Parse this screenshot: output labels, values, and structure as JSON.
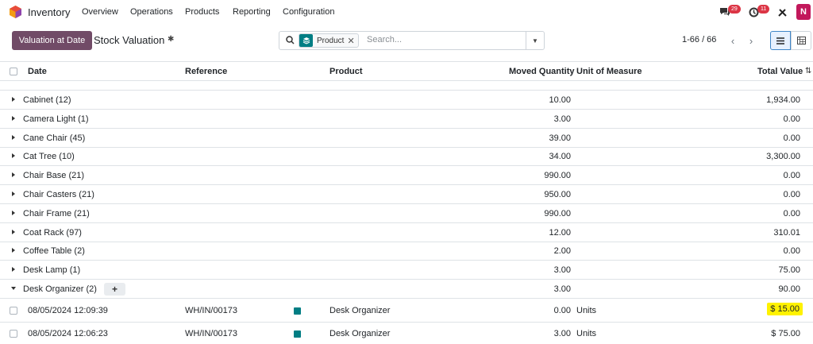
{
  "nav": {
    "app_name": "Inventory",
    "menus": [
      "Overview",
      "Operations",
      "Products",
      "Reporting",
      "Configuration"
    ],
    "chat_badge": "29",
    "activity_badge": "11",
    "user_initial": "N",
    "brand_color": "#714b67"
  },
  "control": {
    "valuation_button": "Valuation at Date",
    "title": "Stock Valuation",
    "facet_label": "Product",
    "search_placeholder": "Search...",
    "pager": "1-66 / 66"
  },
  "table": {
    "headers": {
      "date": "Date",
      "reference": "Reference",
      "product": "Product",
      "moved_quantity": "Moved Quantity",
      "uom": "Unit of Measure",
      "total_value": "Total Value"
    },
    "groups": [
      {
        "label": "Cabinet (12)",
        "qty": "10.00",
        "value": "1,934.00"
      },
      {
        "label": "Camera Light (1)",
        "qty": "3.00",
        "value": "0.00"
      },
      {
        "label": "Cane Chair (45)",
        "qty": "39.00",
        "value": "0.00"
      },
      {
        "label": "Cat Tree (10)",
        "qty": "34.00",
        "value": "3,300.00"
      },
      {
        "label": "Chair Base (21)",
        "qty": "990.00",
        "value": "0.00"
      },
      {
        "label": "Chair Casters (21)",
        "qty": "950.00",
        "value": "0.00"
      },
      {
        "label": "Chair Frame (21)",
        "qty": "990.00",
        "value": "0.00"
      },
      {
        "label": "Coat Rack (97)",
        "qty": "12.00",
        "value": "310.01"
      },
      {
        "label": "Coffee Table (2)",
        "qty": "2.00",
        "value": "0.00"
      },
      {
        "label": "Desk Lamp (1)",
        "qty": "3.00",
        "value": "75.00"
      }
    ],
    "open_group": {
      "label": "Desk Organizer (2)",
      "qty": "3.00",
      "value": "90.00"
    },
    "records": [
      {
        "date": "08/05/2024 12:09:39",
        "reference": "WH/IN/00173",
        "product": "Desk Organizer",
        "qty": "0.00",
        "uom": "Units",
        "value": "$ 15.00",
        "highlight": "#fff200"
      },
      {
        "date": "08/05/2024 12:06:23",
        "reference": "WH/IN/00173",
        "product": "Desk Organizer",
        "qty": "3.00",
        "uom": "Units",
        "value": "$ 75.00"
      }
    ]
  }
}
